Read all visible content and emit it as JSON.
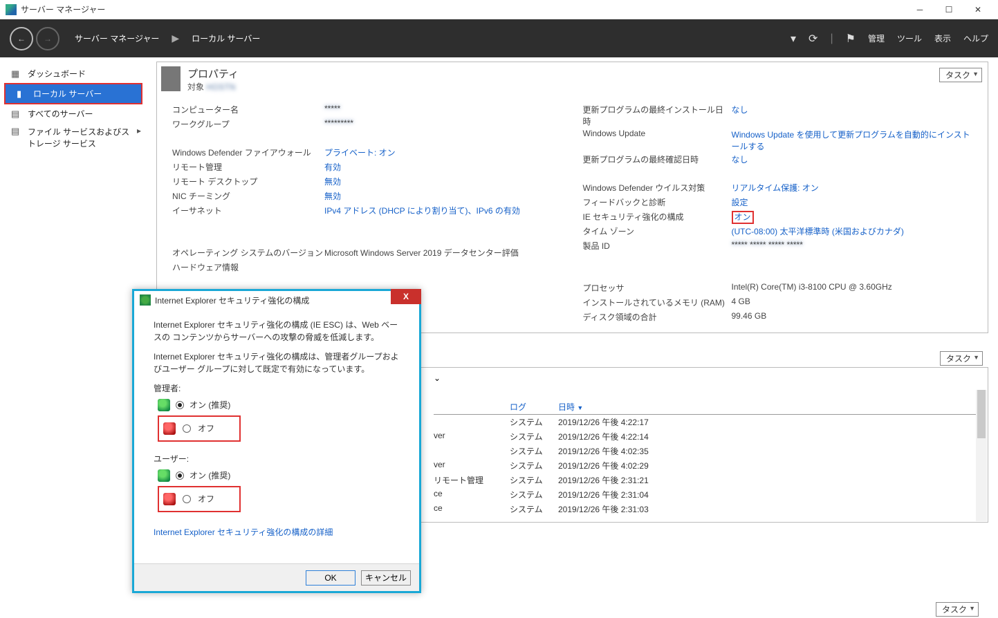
{
  "window": {
    "title": "サーバー マネージャー"
  },
  "breadcrumb": {
    "root": "サーバー マネージャー",
    "current": "ローカル サーバー"
  },
  "menu": {
    "manage": "管理",
    "tools": "ツール",
    "view": "表示",
    "help": "ヘルプ"
  },
  "sidebar": {
    "items": [
      {
        "label": "ダッシュボード"
      },
      {
        "label": "ローカル サーバー"
      },
      {
        "label": "すべてのサーバー"
      },
      {
        "label": "ファイル サービスおよびストレージ サービス"
      }
    ]
  },
  "properties": {
    "title": "プロパティ",
    "sub": "対象",
    "tasks": "タスク",
    "left": [
      {
        "label": "コンピューター名",
        "value": "*****",
        "kind": "blur"
      },
      {
        "label": "ワークグループ",
        "value": "*********",
        "kind": "blur"
      },
      {
        "spacer": true
      },
      {
        "label": "Windows Defender ファイアウォール",
        "value": "プライベート: オン",
        "kind": "link"
      },
      {
        "label": "リモート管理",
        "value": "有効",
        "kind": "link"
      },
      {
        "label": "リモート デスクトップ",
        "value": "無効",
        "kind": "link"
      },
      {
        "label": "NIC チーミング",
        "value": "無効",
        "kind": "link"
      },
      {
        "label": "イーサネット",
        "value": "IPv4 アドレス (DHCP により割り当て)、IPv6 の有効",
        "kind": "link"
      },
      {
        "spacer": true
      },
      {
        "spacer": true
      },
      {
        "label": "オペレーティング システムのバージョン",
        "value": "Microsoft Windows Server 2019 データセンター評価",
        "kind": "txt"
      },
      {
        "label": "ハードウェア情報",
        "value": "",
        "kind": "txt"
      }
    ],
    "right": [
      {
        "label": "更新プログラムの最終インストール日時",
        "value": "なし",
        "kind": "link"
      },
      {
        "label": "Windows Update",
        "value": "Windows Update を使用して更新プログラムを自動的にインストールする",
        "kind": "link"
      },
      {
        "label": "更新プログラムの最終確認日時",
        "value": "なし",
        "kind": "link"
      },
      {
        "spacer": true
      },
      {
        "label": "Windows Defender ウイルス対策",
        "value": "リアルタイム保護: オン",
        "kind": "link"
      },
      {
        "label": "フィードバックと診断",
        "value": "設定",
        "kind": "link"
      },
      {
        "label": "IE セキュリティ強化の構成",
        "value": "オン",
        "kind": "link",
        "hl": true
      },
      {
        "label": "タイム ゾーン",
        "value": "(UTC-08:00) 太平洋標準時 (米国およびカナダ)",
        "kind": "link"
      },
      {
        "label": "製品 ID",
        "value": "***** ***** ***** *****",
        "kind": "blur"
      },
      {
        "spacer": true
      },
      {
        "spacer": true
      },
      {
        "label": "プロセッサ",
        "value": "Intel(R) Core(TM) i3-8100 CPU @ 3.60GHz",
        "kind": "txt"
      },
      {
        "label": "インストールされているメモリ (RAM)",
        "value": "4 GB",
        "kind": "txt"
      },
      {
        "label": "ディスク領域の合計",
        "value": "99.46 GB",
        "kind": "txt"
      }
    ]
  },
  "events": {
    "tasks": "タスク",
    "headers": {
      "c1": "",
      "c2": "ログ",
      "c3": "日時"
    },
    "rows": [
      {
        "c1": "",
        "c2": "システム",
        "c3": "2019/12/26 午後 4:22:17"
      },
      {
        "c1": "ver",
        "c2": "システム",
        "c3": "2019/12/26 午後 4:22:14"
      },
      {
        "c1": "",
        "c2": "システム",
        "c3": "2019/12/26 午後 4:02:35"
      },
      {
        "c1": "ver",
        "c2": "システム",
        "c3": "2019/12/26 午後 4:02:29"
      },
      {
        "c1": "リモート管理",
        "c2": "システム",
        "c3": "2019/12/26 午後 2:31:21"
      },
      {
        "c1": "ce",
        "c2": "システム",
        "c3": "2019/12/26 午後 2:31:04"
      },
      {
        "c1": "ce",
        "c2": "システム",
        "c3": "2019/12/26 午後 2:31:03"
      }
    ]
  },
  "dialog": {
    "title": "Internet Explorer セキュリティ強化の構成",
    "p1": "Internet Explorer セキュリティ強化の構成 (IE ESC) は、Web ベースの コンテンツからサーバーへの攻撃の脅威を低減します。",
    "p2": "Internet Explorer セキュリティ強化の構成は、管理者グループおよびユーザー グループに対して既定で有効になっています。",
    "admin": "管理者:",
    "user": "ユーザー:",
    "on": "オン (推奨)",
    "off": "オフ",
    "link": "Internet Explorer セキュリティ強化の構成の詳細",
    "ok": "OK",
    "cancel": "キャンセル"
  },
  "bottom": {
    "tasks": "タスク"
  }
}
